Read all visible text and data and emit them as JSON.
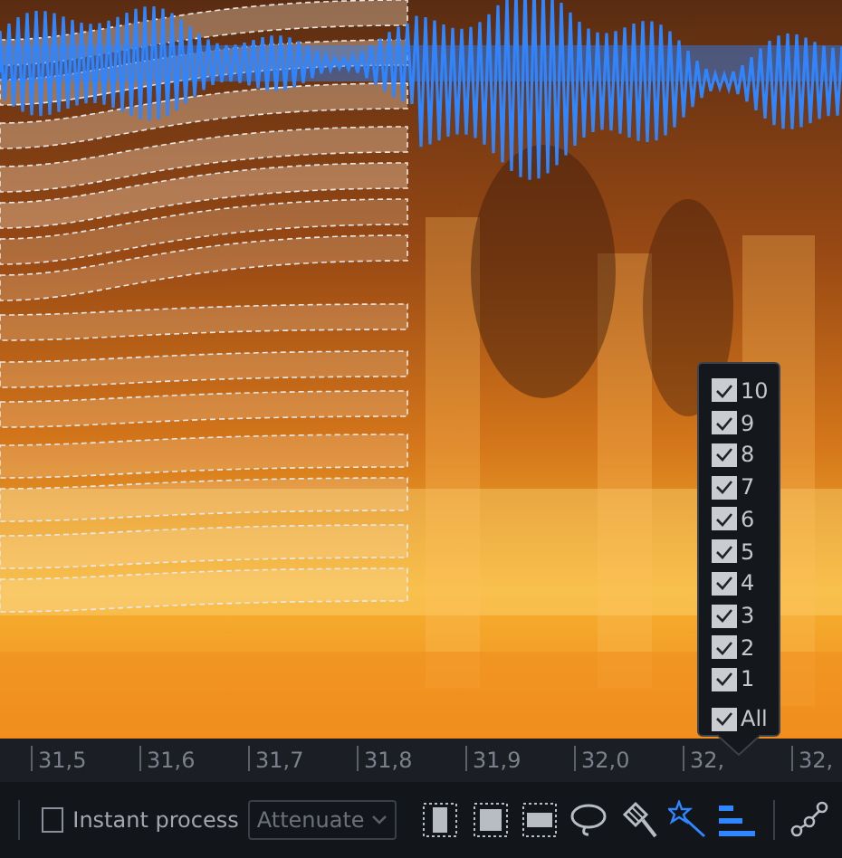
{
  "ruler": {
    "ticks": [
      "31,5",
      "31,6",
      "31,7",
      "31,8",
      "31,9",
      "32,0",
      "32,",
      "32,"
    ]
  },
  "harmonics_menu": {
    "items": [
      {
        "label": "10",
        "checked": true
      },
      {
        "label": "9",
        "checked": true
      },
      {
        "label": "8",
        "checked": true
      },
      {
        "label": "7",
        "checked": true
      },
      {
        "label": "6",
        "checked": true
      },
      {
        "label": "5",
        "checked": true
      },
      {
        "label": "4",
        "checked": true
      },
      {
        "label": "3",
        "checked": true
      },
      {
        "label": "2",
        "checked": true
      },
      {
        "label": "1",
        "checked": true
      },
      {
        "label": "All",
        "checked": true
      }
    ]
  },
  "toolbar": {
    "instant_process": {
      "label": "Instant process",
      "checked": false
    },
    "mode": {
      "value": "Attenuate"
    },
    "tools": [
      {
        "kind": "time",
        "selected": false
      },
      {
        "kind": "rect",
        "selected": false
      },
      {
        "kind": "frequency",
        "selected": false
      },
      {
        "kind": "lasso",
        "selected": false
      },
      {
        "kind": "brush",
        "selected": false
      },
      {
        "kind": "wand",
        "selected": true
      },
      {
        "kind": "harmonic",
        "selected": true
      }
    ],
    "extra_tools": [
      {
        "kind": "path",
        "selected": false
      }
    ]
  }
}
